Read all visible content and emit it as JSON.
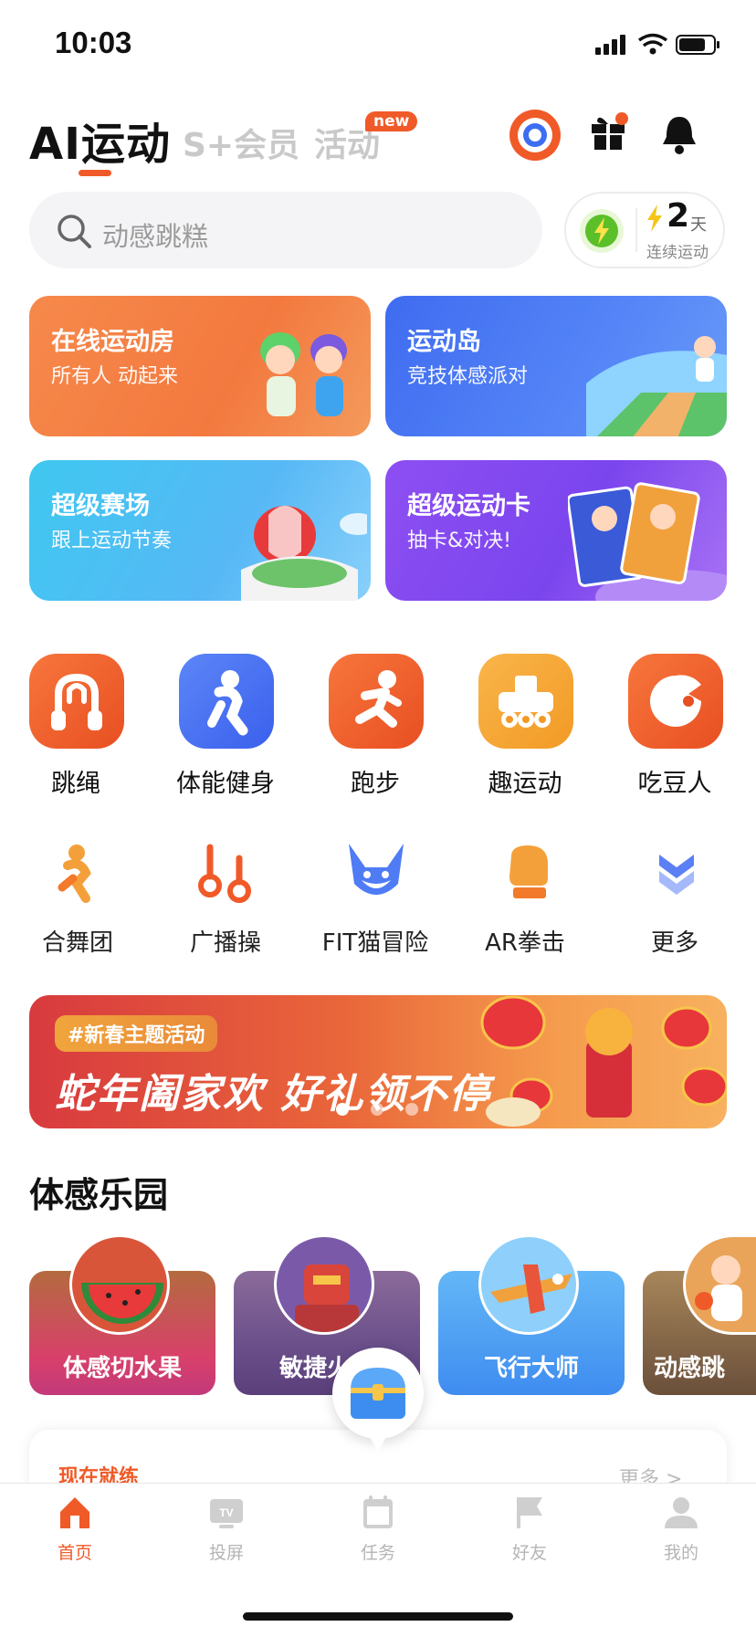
{
  "status_bar": {
    "time": "10:03"
  },
  "header": {
    "tabs": [
      {
        "label": "AI运动",
        "active": true
      },
      {
        "label": "S+会员",
        "active": false
      },
      {
        "label": "活动",
        "active": false,
        "badge": "new"
      }
    ]
  },
  "search": {
    "placeholder": "动感跳糕"
  },
  "streak": {
    "count": "2",
    "unit": "天",
    "label": "连续运动"
  },
  "feature_cards": [
    {
      "title": "在线运动房",
      "subtitle": "所有人 动起来"
    },
    {
      "title": "运动岛",
      "subtitle": "竞技体感派对"
    },
    {
      "title": "超级赛场",
      "subtitle": "跟上运动节奏"
    },
    {
      "title": "超级运动卡",
      "subtitle": "抽卡&对决!"
    }
  ],
  "main_grid": [
    {
      "label": "跳绳",
      "icon": "jump-rope-icon",
      "color": "#f05a28"
    },
    {
      "label": "体能健身",
      "icon": "fitness-icon",
      "color": "#3d6df2"
    },
    {
      "label": "跑步",
      "icon": "running-icon",
      "color": "#f05a28"
    },
    {
      "label": "趣运动",
      "icon": "fun-sport-icon",
      "color": "#f5a623"
    },
    {
      "label": "吃豆人",
      "icon": "pacman-icon",
      "color": "#f05a28"
    }
  ],
  "secondary_grid": [
    {
      "label": "合舞团",
      "icon": "dance-icon"
    },
    {
      "label": "广播操",
      "icon": "broadcast-exercise-icon"
    },
    {
      "label": "FIT猫冒险",
      "icon": "fox-icon"
    },
    {
      "label": "AR拳击",
      "icon": "boxing-glove-icon"
    },
    {
      "label": "更多",
      "icon": "chevron-double-down-icon"
    }
  ],
  "banner": {
    "tag": "#新春主题活动",
    "title": "蛇年阖家欢 好礼领不停"
  },
  "section": {
    "title": "体感乐园"
  },
  "games": [
    {
      "label": "体感切水果"
    },
    {
      "label": "敏捷火枪"
    },
    {
      "label": "飞行大师"
    },
    {
      "label": "动感跳"
    }
  ],
  "now_card": {
    "title": "现在就练",
    "more": "更多 >"
  },
  "tab_bar": [
    {
      "label": "首页",
      "active": true
    },
    {
      "label": "投屏",
      "active": false
    },
    {
      "label": "任务",
      "active": false
    },
    {
      "label": "好友",
      "active": false
    },
    {
      "label": "我的",
      "active": false
    }
  ]
}
